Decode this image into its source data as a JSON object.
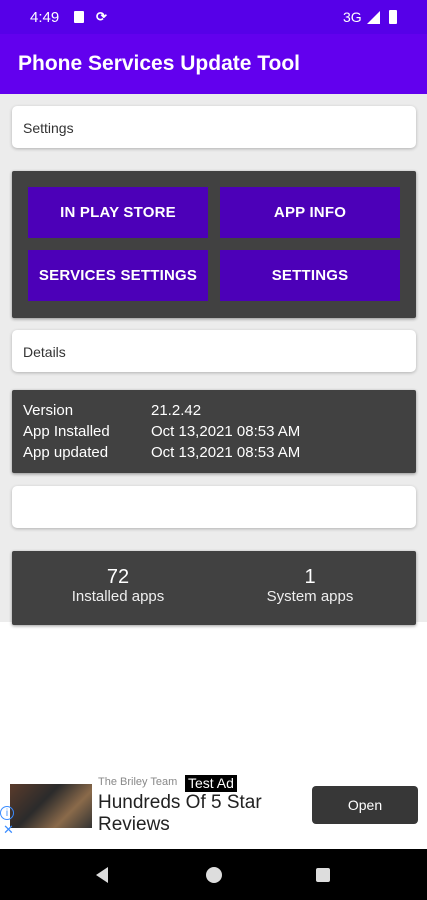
{
  "status_bar": {
    "time": "4:49",
    "network": "3G"
  },
  "app_bar": {
    "title": "Phone Services Update Tool"
  },
  "settings_section": {
    "header": "Settings",
    "buttons": [
      "IN PLAY STORE",
      "APP INFO",
      "SERVICES SETTINGS",
      "SETTINGS"
    ]
  },
  "details_section": {
    "header": "Details",
    "rows": [
      {
        "key": "Version",
        "value": "21.2.42"
      },
      {
        "key": "App Installed",
        "value": "Oct 13,2021 08:53 AM"
      },
      {
        "key": "App updated",
        "value": "Oct 13,2021 08:53 AM"
      }
    ]
  },
  "stats": [
    {
      "count": "72",
      "label": "Installed apps"
    },
    {
      "count": "1",
      "label": "System apps"
    }
  ],
  "ad": {
    "advertiser": "The Briley Team",
    "badge": "Test Ad",
    "headline": "Hundreds Of 5 Star Reviews",
    "cta": "Open"
  },
  "colors": {
    "primary": "#6200ee",
    "status": "#5600e8",
    "button": "#4c00b8",
    "panel": "#414141"
  }
}
